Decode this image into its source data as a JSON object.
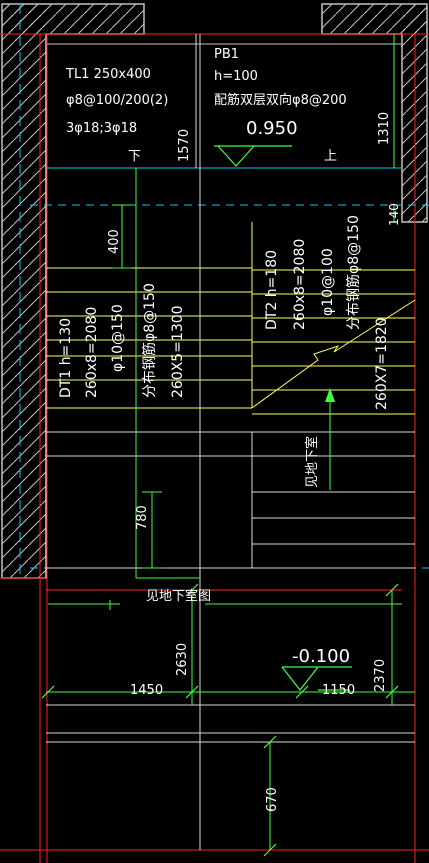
{
  "drawing": {
    "tl1_lines": [
      "TL1 250x400",
      "φ8@100/200(2)",
      "3φ18;3φ18"
    ],
    "pb1_lines": [
      "PB1",
      "h=100",
      "配筋双层双向φ8@200"
    ],
    "elevation_top": "0.950",
    "elevation_bottom": "-0.100",
    "down_label": "下",
    "up_label": "上",
    "dim_1570": "1570",
    "dim_1310": "1310",
    "dim_140": "140",
    "dim_400": "400",
    "dim_780": "780",
    "dim_2630": "2630",
    "dim_2370": "2370",
    "dim_1450": "1450",
    "dim_1150": "1150",
    "dim_670": "670",
    "dt1_lines": [
      "DT1 h=130",
      "260x8=2080",
      "φ10@150"
    ],
    "dt1_dist": "分布钢筋φ8@150",
    "dt1_steps": "260X5=1300",
    "dt2_lines": [
      "DT2 h=180",
      "260x8=2080",
      "φ10@100"
    ],
    "dt2_dist": "分布钢筋φ8@150",
    "dt2_steps": "260X7=1820",
    "see_basement_1": "见地下室图",
    "see_basement_2": "见地下室"
  },
  "colors": {
    "background": "#000000",
    "wall": "#c8c0b8",
    "red": "#ff2020",
    "cyan": "#00c8ff",
    "yellow": "#ffff60",
    "green": "#40ff40",
    "white": "#ffffff"
  }
}
